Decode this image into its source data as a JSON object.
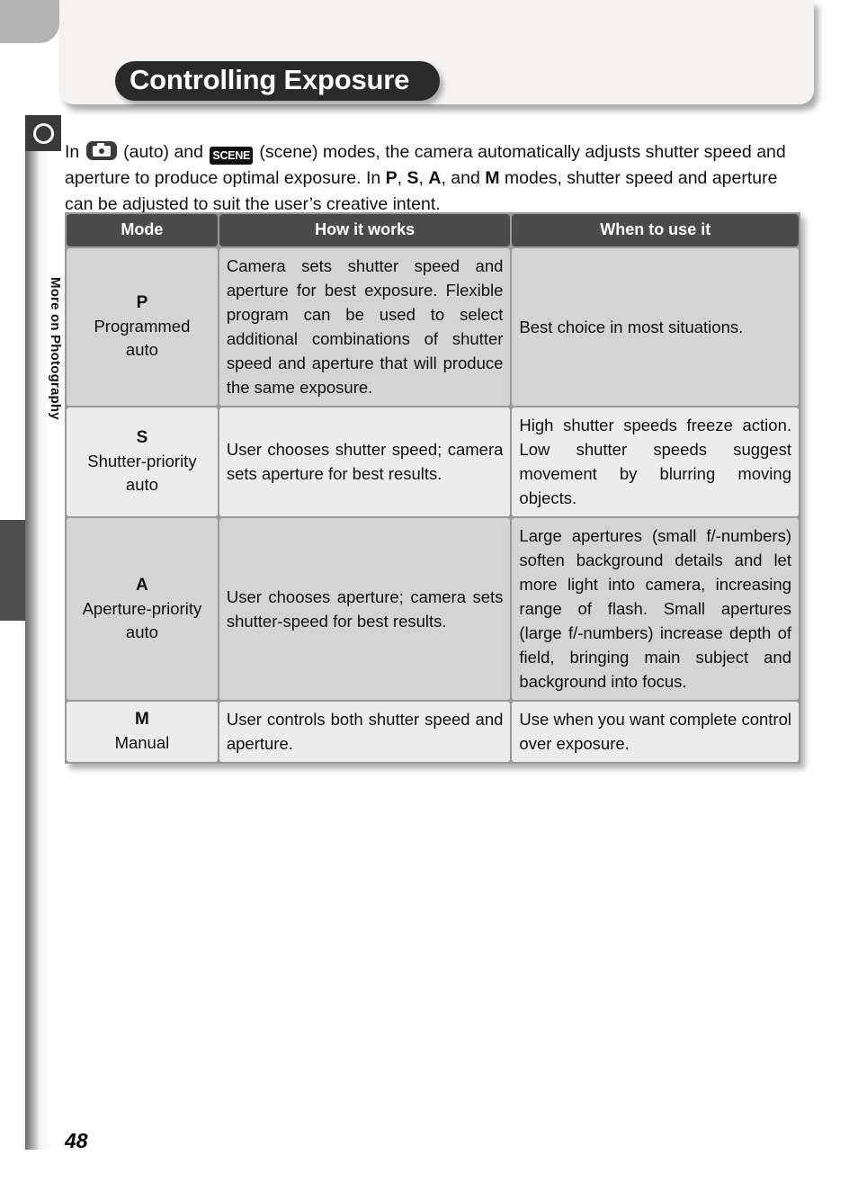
{
  "page": {
    "number": "48",
    "side_tab_label": "More on Photography",
    "side_marker_icon": "ring-icon"
  },
  "header": {
    "title": "Controlling Exposure"
  },
  "intro": {
    "part1": "In ",
    "auto_icon_name": "camera-auto-icon",
    "part2": " (auto) and ",
    "scene_icon_label": "SCENE",
    "scene_icon_name": "scene-mode-icon",
    "part3": " (scene) modes, the camera automatically adjusts shutter speed and aperture to produce optimal exposure.  In ",
    "mode_p": "P",
    "sep1": ", ",
    "mode_s": "S",
    "sep2": ", ",
    "mode_a": "A",
    "sep3": ", and ",
    "mode_m": "M",
    "part4": " modes, shutter speed and aperture can be adjusted to suit the user’s creative intent."
  },
  "table": {
    "headers": [
      "Mode",
      "How it works",
      "When to use it"
    ],
    "rows": [
      {
        "letter": "P",
        "name_line1": "Programmed",
        "name_line2": "auto",
        "how": "Camera sets shutter speed and aperture for best exposure.  Flexible program can be used to select additional combinations of shutter speed and aperture that will produce the same exposure.",
        "when": "Best choice in most situations."
      },
      {
        "letter": "S",
        "name_line1": "Shutter-priority",
        "name_line2": "auto",
        "how": "User chooses shutter speed; camera sets aperture for best results.",
        "when": "High shutter speeds freeze action.  Low shutter speeds suggest movement by blurring moving objects."
      },
      {
        "letter": "A",
        "name_line1": "Aperture-priority",
        "name_line2": "auto",
        "how": "User chooses aperture; camera sets shutter-speed for best results.",
        "when": "Large apertures (small f/-numbers) soften background details and let more light into camera, increasing range of flash.  Small apertures (large f/-numbers) increase depth of field, bringing main subject and background into focus."
      },
      {
        "letter": "M",
        "name_line1": "Manual",
        "name_line2": "",
        "how": "User controls both shutter speed and aperture.",
        "when": "Use when you want complete control over exposure."
      }
    ]
  },
  "colors": {
    "banner_bg": "#2b2a2a",
    "header_panel_bg": "#f4f3f1",
    "table_header_bg": "#4b4b4b",
    "row_dark": "#d4d4d4",
    "row_light": "#ececec",
    "index_tab": "#4e4e4e"
  }
}
